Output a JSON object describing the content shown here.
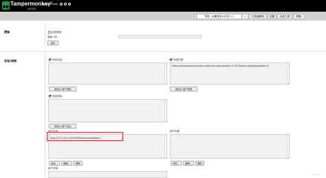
{
  "header": {
    "brand": "Tampermonkey",
    "brand_mark": "®",
    "byline": "by Jan Biniok",
    "version": "v4.19.0"
  },
  "tabs": [
    {
      "label": "脚本: 设置背色为红色 0.1",
      "active": true
    },
    {
      "label": "×"
    },
    {
      "label": "已安装脚本"
    },
    {
      "label": "设置"
    },
    {
      "label": "实用工具"
    },
    {
      "label": "帮助"
    }
  ],
  "update": {
    "title": "更新",
    "check_label": "检查更新",
    "check_on": false,
    "url_label": "更新 URL",
    "save_label": "保存"
  },
  "includes": {
    "title": "包括/排除",
    "add_include_label": "添加包括",
    "add_include_on": true,
    "add_include_btn": "添加为 用户排除",
    "add_exclude_label": "添加排除",
    "add_exclude_on": true,
    "add_exclude_btn": "添加为 用户包括",
    "add_match_label": "添加匹配",
    "add_match_on": true,
    "match_value": "https://www.tampermonkey.net/index.php?version=4.19.0&ext=dhdg&updated=tr",
    "add_match_btn": "添加为 用户排除",
    "user_include_title": "用户包括",
    "user_include_value": "http://172.16.3.122:8090/home/showDevs*",
    "user_match_title": "用户匹配",
    "user_exclude_title": "用户排除",
    "add_label": "添加...",
    "edit_label": "编辑...",
    "delete_label": "删除"
  },
  "colors": {
    "header_bg": "#000000",
    "logo_bg": "#1f9d3a",
    "highlight": "#e3242b",
    "checkbox": "#2d6fd6"
  },
  "watermark": "CSDN @..."
}
